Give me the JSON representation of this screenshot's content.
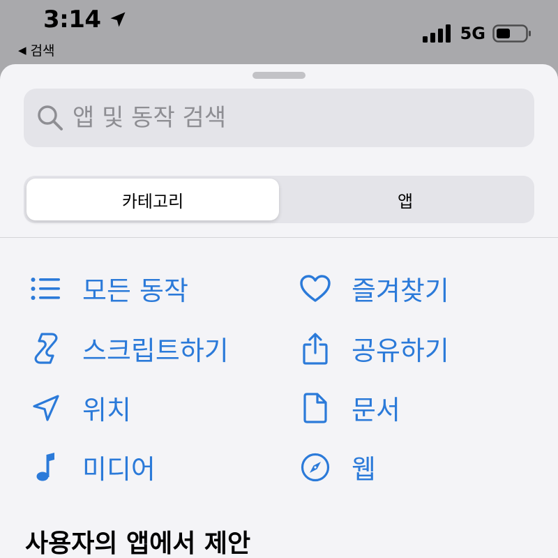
{
  "status_bar": {
    "time": "3:14",
    "network": "5G",
    "back_label": "검색"
  },
  "search": {
    "placeholder": "앱 및 동작 검색"
  },
  "segments": [
    {
      "label": "카테고리",
      "selected": true
    },
    {
      "label": "앱",
      "selected": false
    }
  ],
  "categories": [
    {
      "label": "모든 동작",
      "icon": "list-icon"
    },
    {
      "label": "즐겨찾기",
      "icon": "heart-icon"
    },
    {
      "label": "스크립트하기",
      "icon": "script-icon"
    },
    {
      "label": "공유하기",
      "icon": "share-icon"
    },
    {
      "label": "위치",
      "icon": "location-icon"
    },
    {
      "label": "문서",
      "icon": "document-icon"
    },
    {
      "label": "미디어",
      "icon": "music-note-icon"
    },
    {
      "label": "웹",
      "icon": "compass-icon"
    }
  ],
  "suggestions": {
    "title": "사용자의 앱에서 제안"
  },
  "colors": {
    "accent": "#2b7ad9",
    "backdrop": "#a9a9ac",
    "sheet": "#f4f4f7",
    "field": "#e4e4e9"
  }
}
